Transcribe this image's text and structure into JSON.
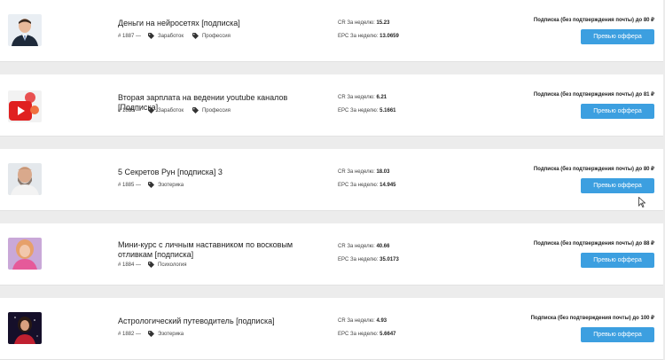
{
  "offers": [
    {
      "title": "Деньги на нейросетях [подписка]",
      "id": "# 1887 —",
      "tags": [
        "Заработок",
        "Профессия"
      ],
      "cr_label": "CR За неделю:",
      "cr_value": "15.23",
      "epc_label": "EPC За неделю:",
      "epc_value": "13.0659",
      "subscription": "Подписка (без подтверждения почты) до 80 ₽",
      "button": "Превью оффера",
      "thumb_icon": "man-in-suit-portrait"
    },
    {
      "title": "Вторая зарплата на ведении youtube каналов [Подписка]",
      "id": "# 1886 —",
      "tags": [
        "Заработок",
        "Профессия"
      ],
      "cr_label": "CR За неделю:",
      "cr_value": "6.21",
      "epc_label": "EPC За неделю:",
      "epc_value": "5.1661",
      "subscription": "Подписка (без подтверждения почты) до 81 ₽",
      "button": "Превью оффера",
      "thumb_icon": "youtube-play-icon"
    },
    {
      "title": "5 Секретов Рун [подписка] 3",
      "id": "# 1885 —",
      "tags": [
        "Эзотерика"
      ],
      "cr_label": "CR За неделю:",
      "cr_value": "18.03",
      "epc_label": "EPC За неделю:",
      "epc_value": "14.945",
      "subscription": "Подписка (без подтверждения почты) до 80 ₽",
      "button": "Превью оффера",
      "thumb_icon": "bearded-man-portrait"
    },
    {
      "title": "Мини-курс с личным наставником по восковым отливкам [подписка]",
      "id": "# 1884 —",
      "tags": [
        "Психология"
      ],
      "cr_label": "CR За неделю:",
      "cr_value": "40.66",
      "epc_label": "EPC За неделю:",
      "epc_value": "35.0173",
      "subscription": "Подписка (без подтверждения почты) до 88 ₽",
      "button": "Превью оффера",
      "thumb_icon": "woman-portrait"
    },
    {
      "title": "Астрологический путеводитель [подписка]",
      "id": "# 1882 —",
      "tags": [
        "Эзотерика"
      ],
      "cr_label": "CR За неделю:",
      "cr_value": "4.93",
      "epc_label": "EPC За неделю:",
      "epc_value": "5.6647",
      "subscription": "Подписка (без подтверждения почты) до 100 ₽",
      "button": "Превью оффера",
      "thumb_icon": "night-sky-portrait"
    }
  ],
  "colors": {
    "button": "#3c9fe0",
    "card": "#ffffff",
    "background": "#ececec"
  }
}
